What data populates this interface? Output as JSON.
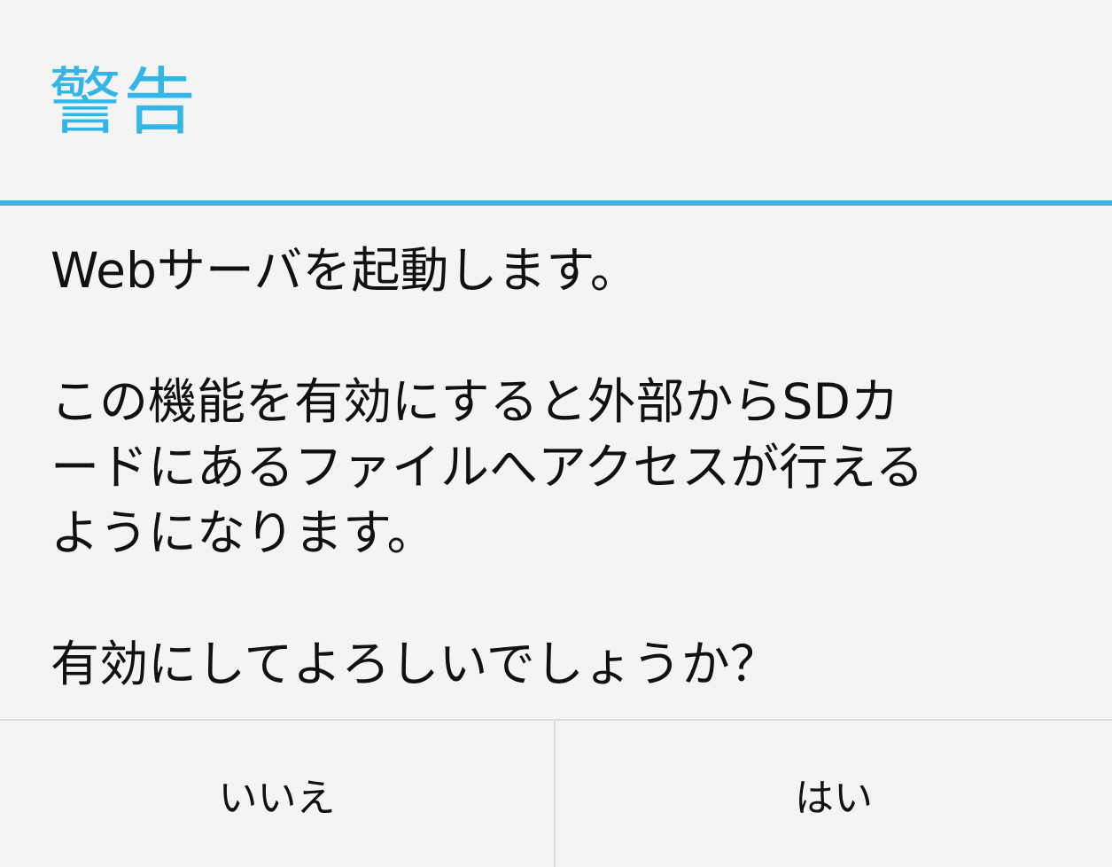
{
  "dialog": {
    "title": "警告",
    "message": {
      "line1": "Webサーバを起動します。",
      "line2": "この機能を有効にすると外部からSDカ",
      "line3": "ードにあるファイルへアクセスが行える",
      "line4": "ようになります。",
      "line5": "有効にしてよろしいでしょうか？"
    },
    "buttons": {
      "negative_label": "いいえ",
      "positive_label": "はい"
    }
  },
  "colors": {
    "accent": "#33b5e5",
    "background": "#f4f4f4",
    "text": "#111111",
    "divider": "#dcdcdc"
  }
}
